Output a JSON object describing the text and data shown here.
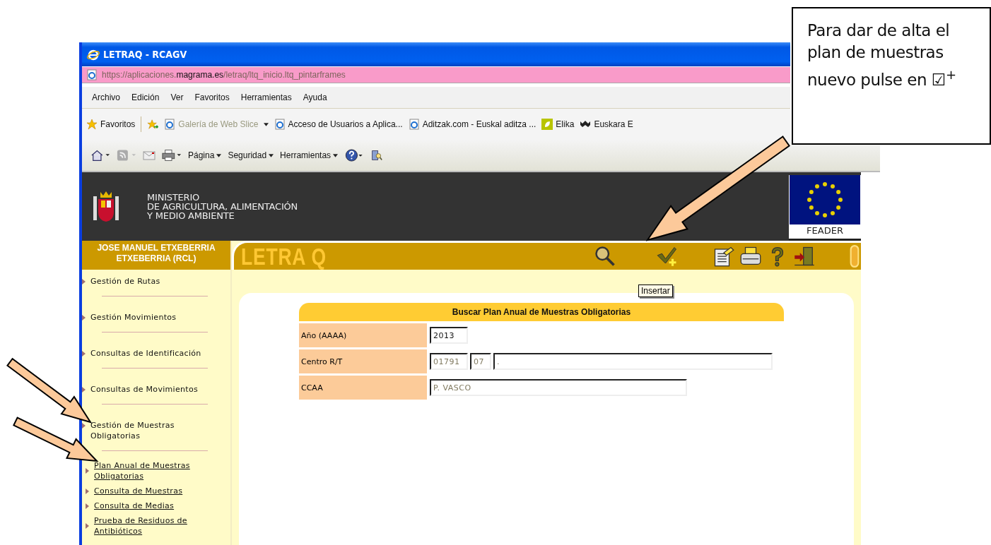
{
  "window": {
    "title": "LETRAQ - RCAGV"
  },
  "address": {
    "prefix": "https://aplicaciones.",
    "domain": "magrama.es",
    "path": "/letraq/ltq_inicio.ltq_pintarframes"
  },
  "menu": [
    "Archivo",
    "Edición",
    "Ver",
    "Favoritos",
    "Herramientas",
    "Ayuda"
  ],
  "favorites_bar": {
    "label": "Favoritos",
    "items": [
      {
        "label": "Galería de Web Slice",
        "kind": "ie",
        "disabled": true,
        "dropdown": true
      },
      {
        "label": "Acceso de Usuarios a Aplica...",
        "kind": "ie",
        "disabled": false,
        "dropdown": false
      },
      {
        "label": "Aditzak.com - Euskal aditza ...",
        "kind": "ie",
        "disabled": false,
        "dropdown": false
      },
      {
        "label": "Elika",
        "kind": "leaf",
        "disabled": false,
        "dropdown": false
      },
      {
        "label": "Euskara E",
        "kind": "logo",
        "disabled": false,
        "dropdown": false
      }
    ]
  },
  "command_bar": [
    "Página",
    "Seguridad",
    "Herramientas"
  ],
  "header": {
    "ministry": [
      "MINISTERIO",
      "DE AGRICULTURA, ALIMENTACIÓN",
      "Y MEDIO AMBIENTE"
    ],
    "eu_label": "FEADER"
  },
  "user": "JOSE MANUEL ETXEBERRIA ETXEBERRIA (RCL)",
  "app_title": "LETRA Q",
  "tooltip": "Insertar",
  "sidebar": [
    {
      "label": "Gestión de Rutas"
    },
    {
      "label": "Gestión Movimientos"
    },
    {
      "label": "Consultas de Identificación"
    },
    {
      "label": "Consultas de Movimientos"
    },
    {
      "label": "Gestión de Muestras Obligatorias",
      "children": [
        {
          "label": "Plan Anual de Muestras Obligatorias"
        },
        {
          "label": "Consulta de Muestras"
        },
        {
          "label": "Consulta de Medias"
        },
        {
          "label": "Prueba de Residuos de Antibióticos"
        }
      ]
    }
  ],
  "form": {
    "title": "Buscar Plan Anual de Muestras Obligatorias",
    "rows": [
      {
        "label": "Año (AAAA)",
        "fields": [
          {
            "value": "2013",
            "kind": "short",
            "disabled": false
          }
        ]
      },
      {
        "label": "Centro R/T",
        "fields": [
          {
            "value": "01791",
            "kind": "short",
            "disabled": true
          },
          {
            "value": "07",
            "kind": "tiny",
            "disabled": true
          },
          {
            "value": ".",
            "kind": "long",
            "disabled": true
          }
        ]
      },
      {
        "label": "CCAA",
        "fields": [
          {
            "value": "P. VASCO",
            "kind": "medium",
            "disabled": true
          }
        ]
      }
    ]
  },
  "callout": "Para dar de alta el plan de muestras nuevo pulse en ☑$^{+}$"
}
